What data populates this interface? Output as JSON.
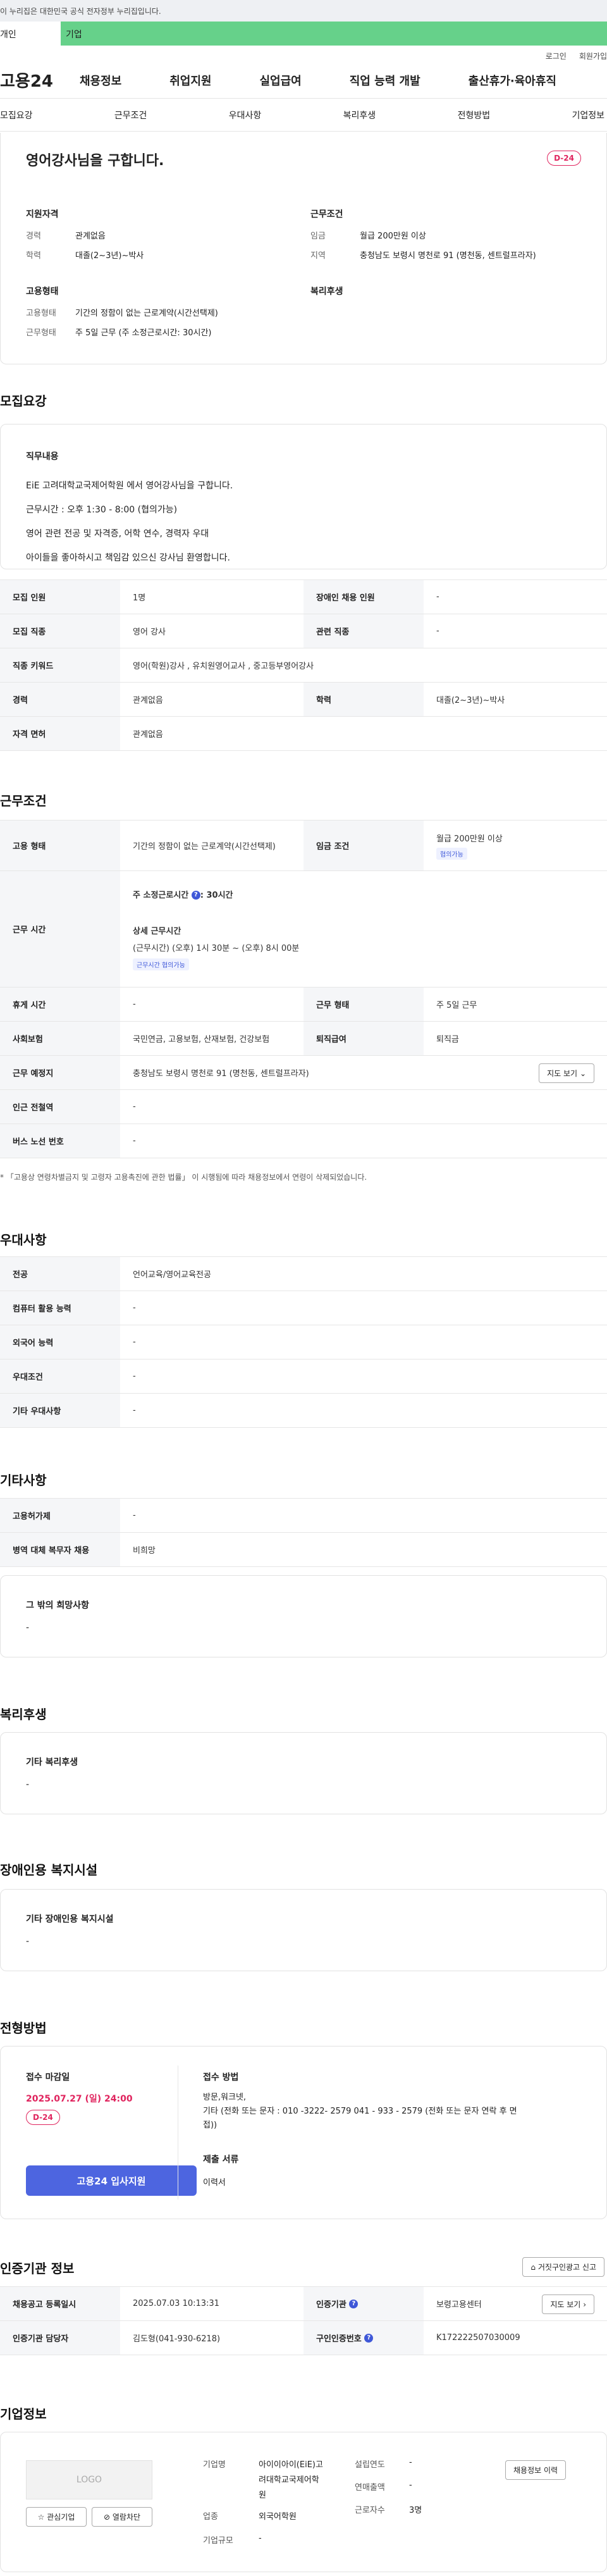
{
  "gov_banner": "이 누리집은 대한민국 공식 전자정부 누리집입니다.",
  "user_tabs": [
    "개인",
    "기업"
  ],
  "util_links": [
    "로그인",
    "회원가입"
  ],
  "gnb": {
    "logo": "고용24",
    "items": [
      "채용정보",
      "취업지원",
      "실업급여",
      "직업 능력 개발",
      "출산휴가·육아휴직"
    ]
  },
  "subnav": [
    "모집요강",
    "근무조건",
    "우대사항",
    "복리후생",
    "전형방법",
    "기업정보"
  ],
  "summary": {
    "title": "영어강사님을 구합니다.",
    "dday": "D-24",
    "qual": {
      "heading": "지원자격",
      "rows": [
        [
          "경력",
          "관계없음"
        ],
        [
          "학력",
          "대졸(2~3년)~박사"
        ]
      ]
    },
    "cond": {
      "heading": "근무조건",
      "rows": [
        [
          "임금",
          "월급 200만원 이상"
        ],
        [
          "지역",
          "충청남도 보령시 명천로 91 (명천동, 센트럴프라자)"
        ]
      ]
    },
    "emp": {
      "heading": "고용형태",
      "rows": [
        [
          "고용형태",
          "기간의 정함이 없는 근로계약(시간선택제)"
        ],
        [
          "근무형태",
          "주 5일 근무 (주 소정근로시간: 30시간)"
        ]
      ]
    },
    "welfare_heading": "복리후생"
  },
  "recruit": {
    "title": "모집요강",
    "job_heading": "직무내용",
    "job_lines": [
      "EiE 고려대학교국제어학원 에서  영어강사님을 구합니다.",
      "근무시간 : 오후 1:30 - 8:00 (협의가능)",
      "영어 관련 전공 및 자격증, 어학 연수, 경력자 우대",
      "아이들을 좋아하시고 책임감 있으신 강사님  환영합니다."
    ],
    "r1": [
      "모집 인원",
      "1명",
      "장애인 채용 인원",
      "-"
    ],
    "r2": [
      "모집 직종",
      "영어 강사",
      "관련 직종",
      "-"
    ],
    "r3": [
      "직종 키워드",
      "영어(학원)강사 , 유치원영어교사 , 중고등부영어강사"
    ],
    "r4": [
      "경력",
      "관계없음",
      "학력",
      "대졸(2~3년)~박사"
    ],
    "r5": [
      "자격 면허",
      "관계없음"
    ]
  },
  "workcond": {
    "title": "근무조건",
    "type_label": "고용 형태",
    "type_value": "기간의 정함이 없는 근로계약(시간선택제)",
    "wage_label": "임금 조건",
    "wage_value": "월급 200만원 이상",
    "wage_tag": "협의가능",
    "time_label": "근무 시간",
    "weekly_label": "주 소정근로시간",
    "weekly_value": ": 30시간",
    "detail_label": "상세 근무시간",
    "detail_value": "(근무시간) (오후) 1시 30분 ~ (오후) 8시 00분",
    "time_tag": "근무시간 협의가능",
    "rest_label": "휴게 시간",
    "rest_value": "-",
    "form_label": "근무 형태",
    "form_value": "주 5일 근무",
    "ins_label": "사회보험",
    "ins_value": "국민연금, 고용보험, 산재보험, 건강보험",
    "sev_label": "퇴직급여",
    "sev_value": "퇴직금",
    "place_label": "근무 예정지",
    "place_value": "충청남도 보령시 명천로 91 (명천동, 센트럴프라자)",
    "map_btn": "지도 보기",
    "station_label": "인근 전철역",
    "station_value": "-",
    "bus_label": "버스 노선 번호",
    "bus_value": "-",
    "notice": "* 「고용상 연령차별금지 및 고령자 고용촉진에 관한 법률」 이 시행됨에 따라 채용정보에서 연령이 삭제되었습니다."
  },
  "prefer": {
    "title": "우대사항",
    "rows": [
      [
        "전공",
        "언어교육/영어교육전공"
      ],
      [
        "컴퓨터 활용 능력",
        "-"
      ],
      [
        "외국어 능력",
        "-"
      ],
      [
        "우대조건",
        "-"
      ],
      [
        "기타 우대사항",
        "-"
      ]
    ]
  },
  "etc": {
    "title": "기타사항",
    "rows": [
      [
        "고용허가제",
        "-"
      ],
      [
        "병역 대체 복무자 채용",
        "비희망"
      ]
    ],
    "box_title": "그 밖의 희망사항",
    "box_value": "-"
  },
  "benefit": {
    "title": "복리후생",
    "box_title": "기타 복리후생",
    "box_value": "-"
  },
  "facility": {
    "title": "장애인용 복지시설",
    "box_title": "기타 장애인용 복지시설",
    "box_value": "-"
  },
  "process": {
    "title": "전형방법",
    "deadline_label": "접수 마감일",
    "deadline_value": "2025.07.27 (일) 24:00",
    "dday": "D-24",
    "apply_btn": "고용24 입사지원",
    "method_label": "접수 방법",
    "method_lines": [
      "방문,워크넷,",
      "기타 (전화 또는 문자 : 010 -3222- 2579   041 - 933 - 2579  (전화 또는 문자 연락 후 면",
      "접))"
    ],
    "docs_label": "제출 서류",
    "docs_value": "이력서"
  },
  "cert": {
    "title": "인증기관 정보",
    "report_btn": "거짓구인광고 신고",
    "r1": [
      "채용공고 등록일시",
      "2025.07.03 10:13:31",
      "인증기관",
      "보령고용센터"
    ],
    "map_btn": "지도 보기",
    "r2": [
      "인증기관 담당자",
      "김도형(041-930-6218)",
      "구인인증번호",
      "K172222507030009"
    ]
  },
  "company": {
    "title": "기업정보",
    "logo_text": "LOGO",
    "fav_btn": "관심기업",
    "block_btn": "열람차단",
    "name_label": "기업명",
    "name_lines": [
      "아이이아이(EiE)고",
      "려대학교국제어학",
      "원"
    ],
    "industry_label": "업종",
    "industry_value": "외국어학원",
    "size_label": "기업규모",
    "size_value": "-",
    "founded_label": "설립연도",
    "founded_value": "-",
    "revenue_label": "연매출액",
    "revenue_value": "-",
    "staff_label": "근로자수",
    "staff_value": "3명",
    "history_btn": "채용정보 이력"
  },
  "colors": {
    "accent": "#4d65e0",
    "dday": "#e0245e",
    "user_tab": "#66d18a"
  }
}
